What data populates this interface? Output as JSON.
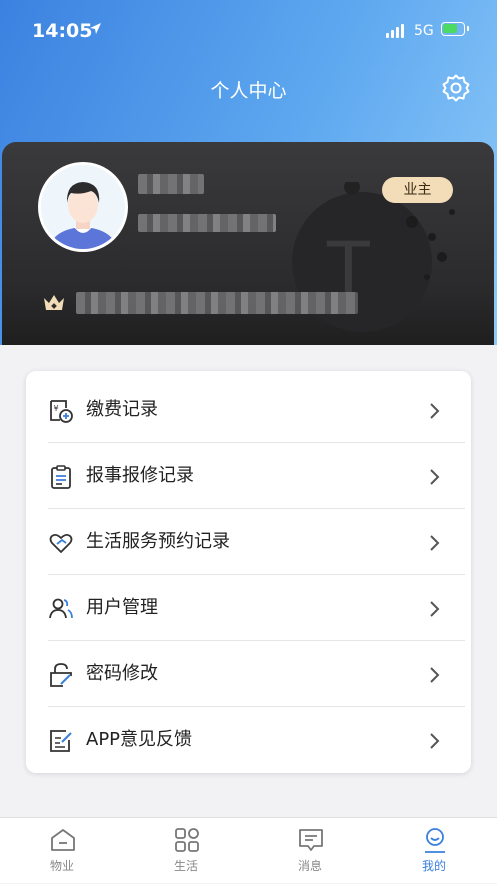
{
  "status_bar": {
    "time": "14:05",
    "network": "5G"
  },
  "header": {
    "title": "个人中心"
  },
  "profile": {
    "role_badge": "业主"
  },
  "menu": {
    "items": [
      {
        "label": "缴费记录",
        "icon": "payment-record-icon"
      },
      {
        "label": "报事报修记录",
        "icon": "clipboard-icon"
      },
      {
        "label": "生活服务预约记录",
        "icon": "heart-service-icon"
      },
      {
        "label": "用户管理",
        "icon": "users-icon"
      },
      {
        "label": "密码修改",
        "icon": "lock-edit-icon"
      },
      {
        "label": "APP意见反馈",
        "icon": "feedback-icon"
      }
    ]
  },
  "tabbar": {
    "tabs": [
      {
        "label": "物业",
        "icon": "home-icon"
      },
      {
        "label": "生活",
        "icon": "grid-icon"
      },
      {
        "label": "消息",
        "icon": "message-icon"
      },
      {
        "label": "我的",
        "icon": "user-icon",
        "active": true
      }
    ]
  },
  "colors": {
    "accent": "#3a7fdc",
    "badge_bg": "#f3dcb8",
    "card_bg": "#2b2b2d"
  }
}
